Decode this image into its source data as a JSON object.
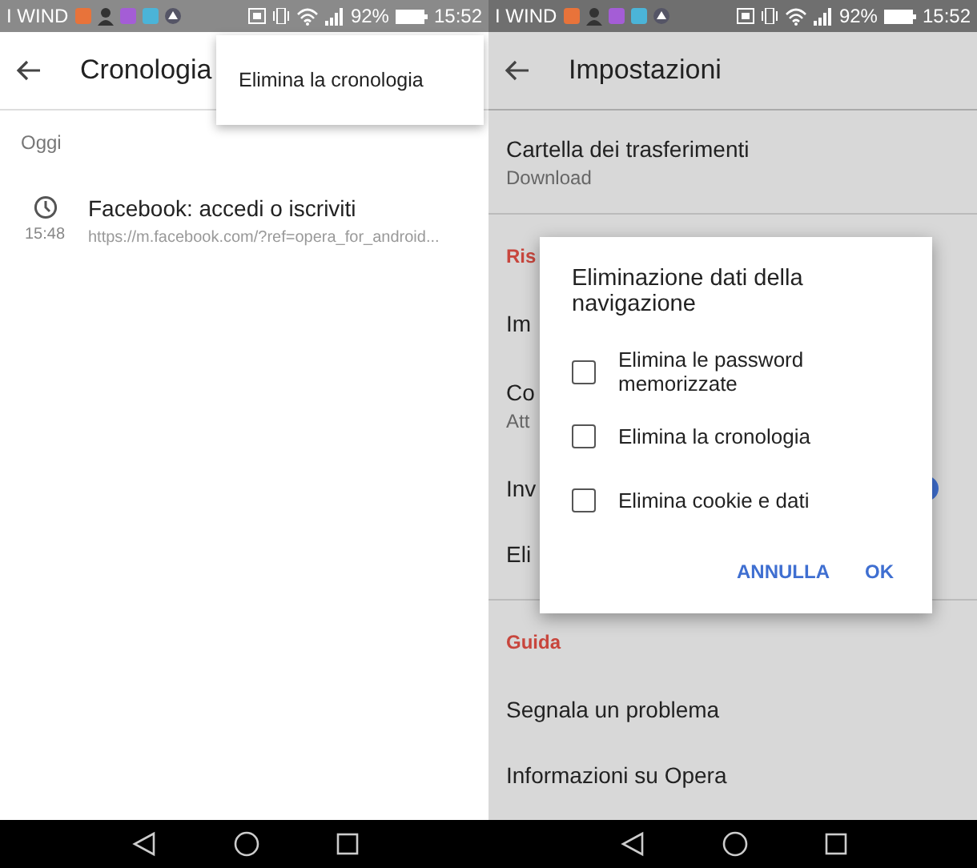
{
  "screens": [
    {
      "status_bar": {
        "carrier": "I WIND",
        "battery": "92%",
        "time": "15:52"
      },
      "app_bar": {
        "title": "Cronologia"
      },
      "overflow_menu": {
        "items": [
          "Elimina la cronologia"
        ]
      },
      "history": {
        "section": "Oggi",
        "entries": [
          {
            "title": "Facebook: accedi o iscriviti",
            "time": "15:48",
            "url": "https://m.facebook.com/?ref=opera_for_android..."
          }
        ]
      }
    },
    {
      "status_bar": {
        "carrier": "I WIND",
        "battery": "92%",
        "time": "15:52"
      },
      "app_bar": {
        "title": "Impostazioni"
      },
      "settings": {
        "items": [
          {
            "kind": "item",
            "title": "Cartella dei trasferimenti",
            "subtitle": "Download"
          },
          {
            "kind": "header",
            "title": "Ris"
          },
          {
            "kind": "item",
            "title": "Im"
          },
          {
            "kind": "item",
            "title": "Co",
            "subtitle": "Att"
          },
          {
            "kind": "toggle",
            "title": "Inv",
            "on": true
          },
          {
            "kind": "item",
            "title": "Eli"
          },
          {
            "kind": "header",
            "title": "Guida"
          },
          {
            "kind": "item",
            "title": "Segnala un problema"
          },
          {
            "kind": "item",
            "title": "Informazioni su Opera"
          }
        ]
      },
      "dialog": {
        "title": "Eliminazione dati della navigazione",
        "options": [
          {
            "label": "Elimina le password memorizzate",
            "checked": false
          },
          {
            "label": "Elimina la cronologia",
            "checked": false
          },
          {
            "label": "Elimina cookie e dati",
            "checked": false
          }
        ],
        "buttons": [
          "ANNULLA",
          "OK"
        ]
      }
    }
  ]
}
